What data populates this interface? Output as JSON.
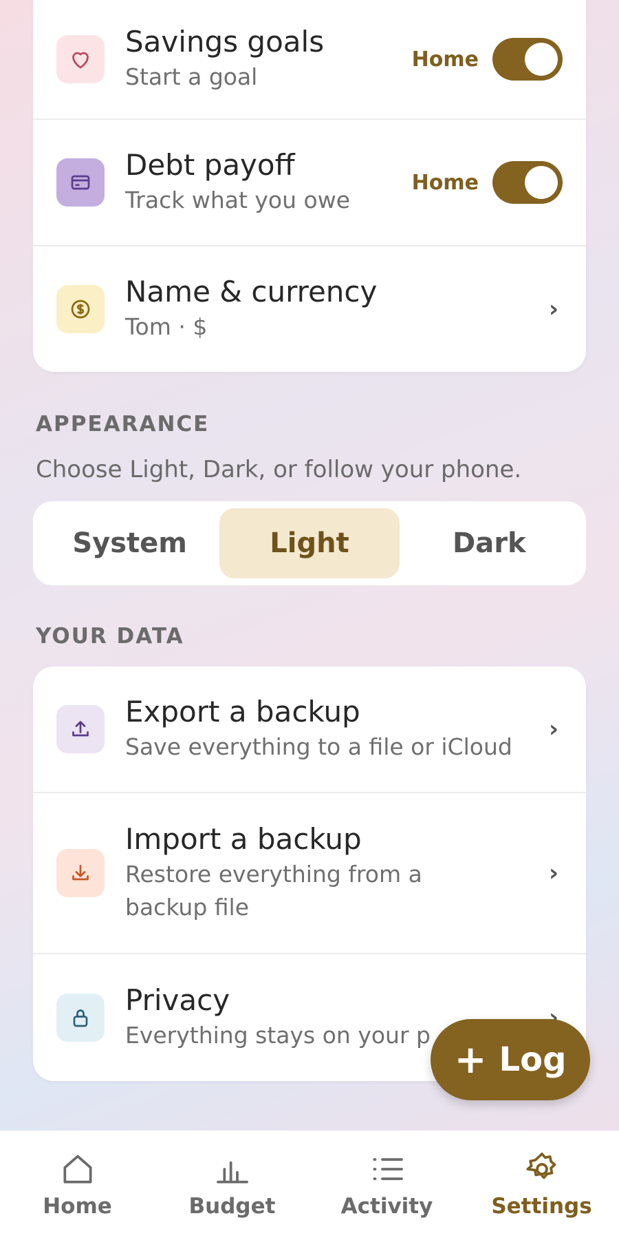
{
  "colors": {
    "accent": "#84621f",
    "accent_text": "#7f5f1f",
    "active_segment": "#f4e8cf"
  },
  "features_card": {
    "rows": [
      {
        "title": "Savings goals",
        "subtitle": "Start a goal",
        "toggle_label": "Home",
        "toggle_on": true,
        "icon": "heart-icon"
      },
      {
        "title": "Debt payoff",
        "subtitle": "Track what you owe",
        "toggle_label": "Home",
        "toggle_on": true,
        "icon": "credit-card-icon"
      },
      {
        "title": "Name & currency",
        "subtitle": "Tom · $",
        "chevron": "›",
        "icon": "dollar-coin-icon"
      }
    ]
  },
  "appearance": {
    "heading": "APPEARANCE",
    "description": "Choose Light, Dark, or follow your phone.",
    "options": [
      "System",
      "Light",
      "Dark"
    ],
    "selected": "Light"
  },
  "your_data": {
    "heading": "YOUR DATA",
    "rows": [
      {
        "title": "Export a backup",
        "subtitle": "Save everything to a file or iCloud",
        "chevron": "›",
        "icon": "upload-icon"
      },
      {
        "title": "Import a backup",
        "subtitle": "Restore everything from a backup file",
        "chevron": "›",
        "icon": "download-icon"
      },
      {
        "title": "Privacy",
        "subtitle": "Everything stays on your p",
        "chevron": "›",
        "icon": "lock-icon"
      }
    ]
  },
  "fab": {
    "plus": "+",
    "label": "Log"
  },
  "tabbar": {
    "tabs": [
      {
        "label": "Home",
        "icon": "home-icon"
      },
      {
        "label": "Budget",
        "icon": "bar-chart-icon"
      },
      {
        "label": "Activity",
        "icon": "list-icon"
      },
      {
        "label": "Settings",
        "icon": "gear-icon"
      }
    ],
    "active": "Settings"
  }
}
